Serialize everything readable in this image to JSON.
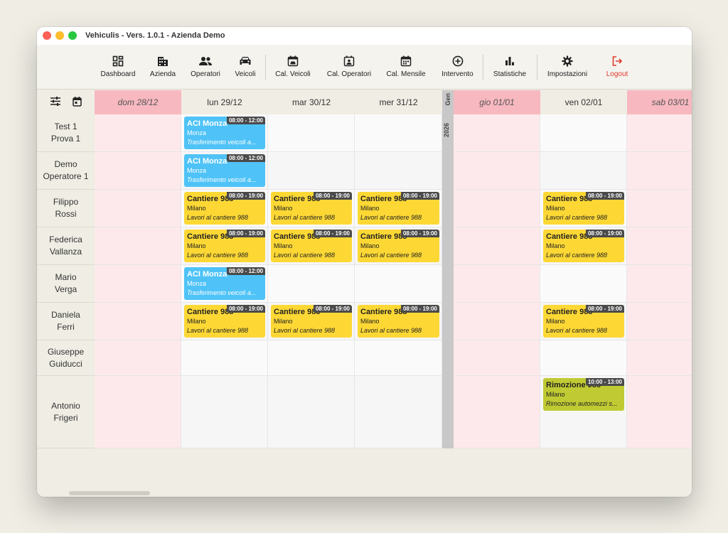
{
  "window": {
    "title": "Vehiculis - Vers. 1.0.1 - Azienda Demo"
  },
  "toolbar": {
    "dashboard": "Dashboard",
    "azienda": "Azienda",
    "operatori": "Operatori",
    "veicoli": "Veicoli",
    "cal_veicoli": "Cal. Veicoli",
    "cal_operatori": "Cal. Operatori",
    "cal_mensile": "Cal. Mensile",
    "intervento": "Intervento",
    "statistiche": "Statistiche",
    "impostazioni": "Impostazioni",
    "logout": "Logout"
  },
  "colors": {
    "weekend_header": "#f7b8c0",
    "weekend_cell": "#fde9eb",
    "event_blue": "#4fc3f7",
    "event_yellow": "#fdd835",
    "event_olive": "#c0ca33",
    "logout": "#e03a2b"
  },
  "calendar": {
    "month_label": "Gen",
    "year_label": "2026",
    "days": [
      {
        "label": "dom 28/12",
        "weekend": true
      },
      {
        "label": "lun 29/12",
        "weekend": false
      },
      {
        "label": "mar 30/12",
        "weekend": false
      },
      {
        "label": "mer 31/12",
        "weekend": false
      },
      {
        "label": "gio 01/01",
        "weekend": true
      },
      {
        "label": "ven 02/01",
        "weekend": false
      },
      {
        "label": "sab 03/01",
        "weekend": true
      }
    ],
    "rows": [
      {
        "name": "Test 1\nProva 1"
      },
      {
        "name": "Demo\nOperatore 1"
      },
      {
        "name": "Filippo\nRossi"
      },
      {
        "name": "Federica\nVallanza"
      },
      {
        "name": "Mario\nVerga"
      },
      {
        "name": "Daniela\nFerri"
      },
      {
        "name": "Giuseppe\nGuiducci"
      },
      {
        "name": "Antonio\nFrigeri"
      }
    ],
    "events": [
      {
        "row": 0,
        "day": 1,
        "color": "blue",
        "title": "ACI Monza",
        "city": "Monza",
        "desc": "Trasferimento veicoli a...",
        "time": "08:00 - 12:00"
      },
      {
        "row": 1,
        "day": 1,
        "color": "blue",
        "title": "ACI Monza",
        "city": "Monza",
        "desc": "Trasferimento veicoli a...",
        "time": "08:00 - 12:00"
      },
      {
        "row": 2,
        "day": 1,
        "color": "yellow",
        "title": "Cantiere 988",
        "city": "Milano",
        "desc": "Lavori al cantiere 988",
        "time": "08:00 - 19:00"
      },
      {
        "row": 2,
        "day": 2,
        "color": "yellow",
        "title": "Cantiere 988",
        "city": "Milano",
        "desc": "Lavori al cantiere 988",
        "time": "08:00 - 19:00"
      },
      {
        "row": 2,
        "day": 3,
        "color": "yellow",
        "title": "Cantiere 988",
        "city": "Milano",
        "desc": "Lavori al cantiere 988",
        "time": "08:00 - 19:00"
      },
      {
        "row": 2,
        "day": 5,
        "color": "yellow",
        "title": "Cantiere 988",
        "city": "Milano",
        "desc": "Lavori al cantiere 988",
        "time": "08:00 - 19:00"
      },
      {
        "row": 3,
        "day": 1,
        "color": "yellow",
        "title": "Cantiere 988",
        "city": "Milano",
        "desc": "Lavori al cantiere 988",
        "time": "08:00 - 19:00"
      },
      {
        "row": 3,
        "day": 2,
        "color": "yellow",
        "title": "Cantiere 988",
        "city": "Milano",
        "desc": "Lavori al cantiere 988",
        "time": "08:00 - 19:00"
      },
      {
        "row": 3,
        "day": 3,
        "color": "yellow",
        "title": "Cantiere 988",
        "city": "Milano",
        "desc": "Lavori al cantiere 988",
        "time": "08:00 - 19:00"
      },
      {
        "row": 3,
        "day": 5,
        "color": "yellow",
        "title": "Cantiere 988",
        "city": "Milano",
        "desc": "Lavori al cantiere 988",
        "time": "08:00 - 19:00"
      },
      {
        "row": 4,
        "day": 1,
        "color": "blue",
        "title": "ACI Monza",
        "city": "Monza",
        "desc": "Trasferimento veicoli a...",
        "time": "08:00 - 12:00"
      },
      {
        "row": 5,
        "day": 1,
        "color": "yellow",
        "title": "Cantiere 988",
        "city": "Milano",
        "desc": "Lavori al cantiere 988",
        "time": "08:00 - 19:00"
      },
      {
        "row": 5,
        "day": 2,
        "color": "yellow",
        "title": "Cantiere 988",
        "city": "Milano",
        "desc": "Lavori al cantiere 988",
        "time": "08:00 - 19:00"
      },
      {
        "row": 5,
        "day": 3,
        "color": "yellow",
        "title": "Cantiere 988",
        "city": "Milano",
        "desc": "Lavori al cantiere 988",
        "time": "08:00 - 19:00"
      },
      {
        "row": 5,
        "day": 5,
        "color": "yellow",
        "title": "Cantiere 988",
        "city": "Milano",
        "desc": "Lavori al cantiere 988",
        "time": "08:00 - 19:00"
      },
      {
        "row": 7,
        "day": 5,
        "color": "olive",
        "title": "Rimozione 988",
        "city": "Milano",
        "desc": "Rimozione automezzi s...",
        "time": "10:00 - 13:00"
      }
    ]
  }
}
